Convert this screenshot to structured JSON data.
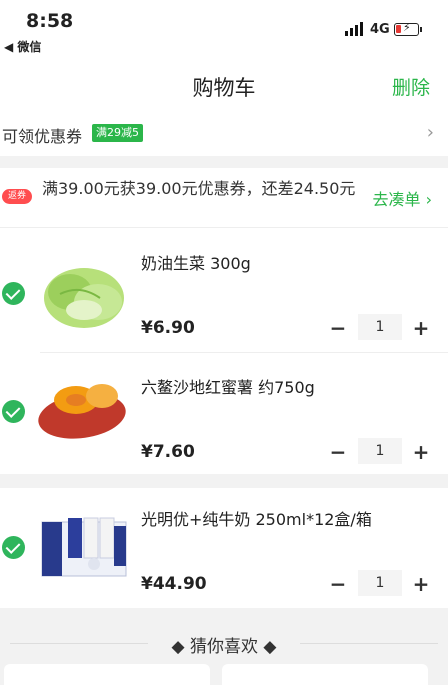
{
  "status": {
    "time": "8:58",
    "back_app": "◀ 微信",
    "network": "4G"
  },
  "nav": {
    "title": "购物车",
    "action": "删除"
  },
  "coupon": {
    "label": "可领优惠券",
    "tag": "满29减5",
    "arrow": "›"
  },
  "promo": {
    "badge": "返券",
    "text": "满39.00元获39.00元优惠券，还差24.50元",
    "link": "去凑单 ›"
  },
  "items": [
    {
      "name": "奶油生菜 300g",
      "price": "¥6.90",
      "qty": "1",
      "image_icon": "lettuce-image"
    },
    {
      "name": "六鳌沙地红蜜薯 约750g",
      "price": "¥7.60",
      "qty": "1",
      "image_icon": "sweet-potato-image"
    },
    {
      "name": "光明优+纯牛奶 250ml*12盒/箱",
      "price": "¥44.90",
      "qty": "1",
      "image_icon": "milk-box-image"
    }
  ],
  "qty_controls": {
    "minus": "−",
    "plus": "+"
  },
  "guess": {
    "title": "◆ 猜你喜欢 ◆"
  },
  "colors": {
    "accent": "#2bb64a",
    "check": "#2fb55c",
    "badge": "#ff4d4f"
  }
}
